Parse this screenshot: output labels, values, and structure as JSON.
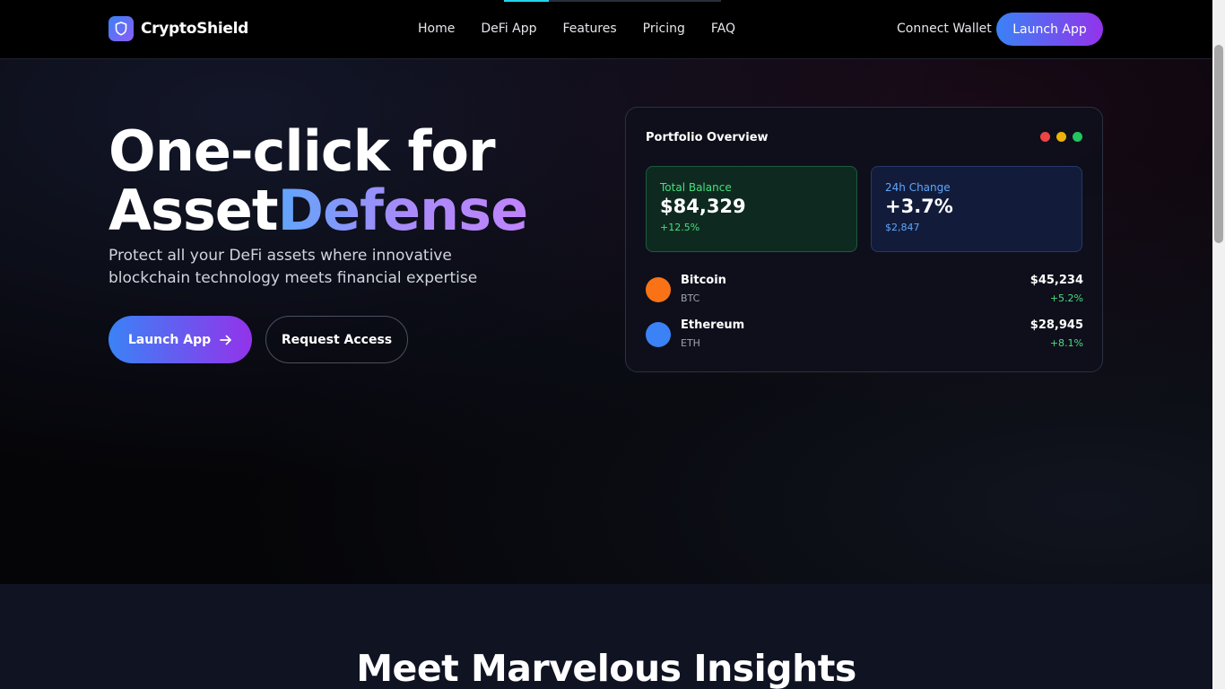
{
  "brand": {
    "name": "CryptoShield"
  },
  "nav": {
    "links": [
      {
        "label": "Home"
      },
      {
        "label": "DeFi App"
      },
      {
        "label": "Features"
      },
      {
        "label": "Pricing"
      },
      {
        "label": "FAQ"
      }
    ],
    "connect_wallet": "Connect Wallet",
    "launch_app": "Launch App"
  },
  "hero": {
    "title_line1": "One-click for",
    "title_line2_plain": "Asset",
    "title_line2_accent": "Defense",
    "subtitle": "Protect all your DeFi assets where innovative blockchain technology meets financial expertise",
    "primary_button": "Launch App",
    "secondary_button": "Request Access"
  },
  "portfolio": {
    "title": "Portfolio Overview",
    "dot_colors": [
      "#ef4444",
      "#eab308",
      "#22c55e"
    ],
    "total_balance": {
      "label": "Total Balance",
      "value": "$84,329",
      "sub": "+12.5%"
    },
    "change_24h": {
      "label": "24h Change",
      "value": "+3.7%",
      "sub": "$2,847"
    },
    "assets": [
      {
        "name": "Bitcoin",
        "symbol": "BTC",
        "price": "$45,234",
        "change": "+5.2%",
        "color": "#f97316"
      },
      {
        "name": "Ethereum",
        "symbol": "ETH",
        "price": "$28,945",
        "change": "+8.1%",
        "color": "#3b82f6"
      }
    ]
  },
  "insights": {
    "title": "Meet Marvelous Insights"
  },
  "colors": {
    "accent_start": "#3b82f6",
    "accent_end": "#9333ea",
    "positive": "#4ade80",
    "highlight": "#22d3ee"
  }
}
